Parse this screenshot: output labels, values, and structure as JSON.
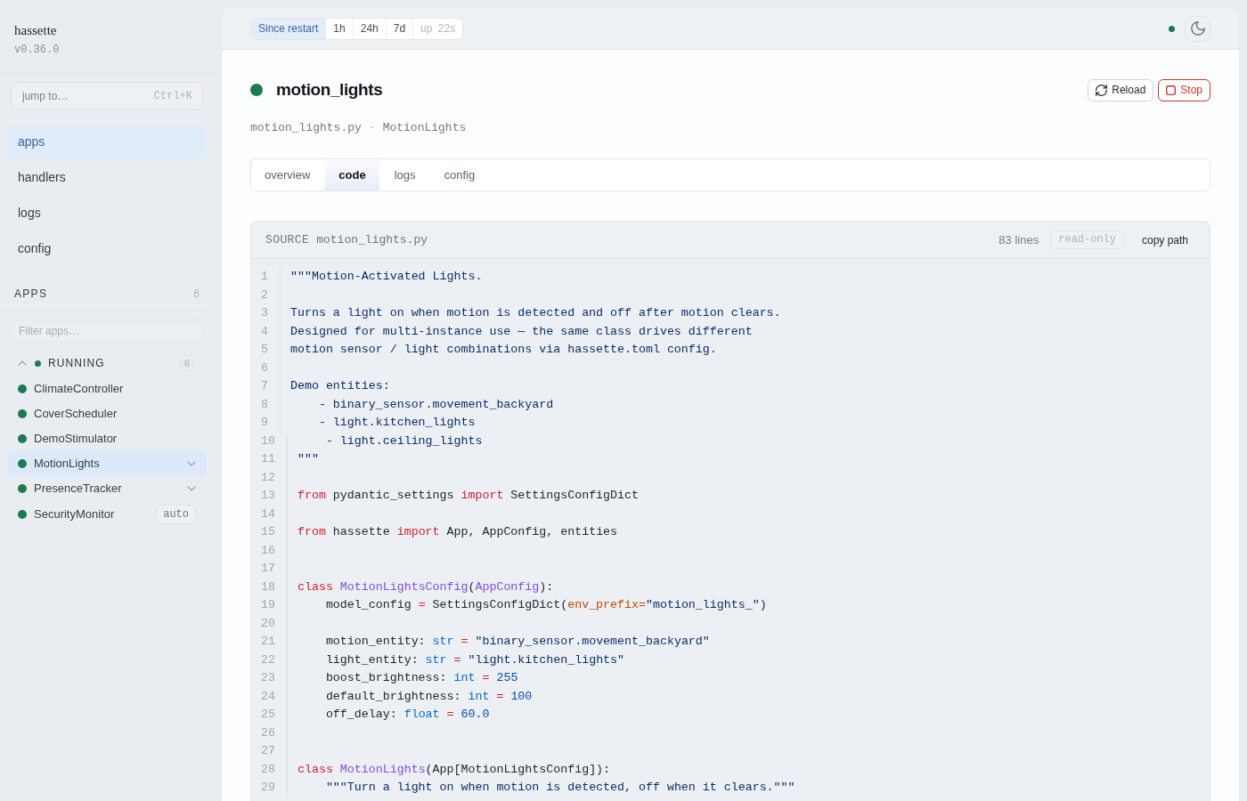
{
  "sidebar": {
    "brand": "hassette",
    "version": "v0.36.0",
    "jump": {
      "placeholder": "jump to…",
      "shortcut": "Ctrl+K"
    },
    "nav": [
      {
        "label": "apps",
        "selected": true
      },
      {
        "label": "handlers",
        "selected": false
      },
      {
        "label": "logs",
        "selected": false
      },
      {
        "label": "config",
        "selected": false
      }
    ],
    "apps_section": {
      "title": "APPS",
      "count": "6",
      "filter_placeholder": "Filter apps…",
      "groups": [
        {
          "label": "RUNNING",
          "running": true,
          "count": "6",
          "expanded": true,
          "apps": [
            {
              "name": "ClimateController",
              "running": true,
              "selected": false,
              "expandable": false
            },
            {
              "name": "CoverScheduler",
              "running": true,
              "selected": false,
              "expandable": false
            },
            {
              "name": "DemoStimulator",
              "running": true,
              "selected": false,
              "expandable": false
            },
            {
              "name": "MotionLights",
              "running": true,
              "selected": true,
              "expandable": true
            },
            {
              "name": "PresenceTracker",
              "running": true,
              "selected": false,
              "expandable": true
            },
            {
              "name": "SecurityMonitor",
              "running": true,
              "selected": false,
              "expandable": false,
              "badge": "auto"
            }
          ]
        }
      ]
    }
  },
  "top_bar": {
    "time_ranges": [
      {
        "label": "Since restart",
        "selected": true
      },
      {
        "label": "1h",
        "selected": false
      },
      {
        "label": "24h",
        "selected": false
      },
      {
        "label": "7d",
        "selected": false
      }
    ],
    "uptime": "up 22s",
    "connected": true
  },
  "app": {
    "name": "motion_lights",
    "running": true,
    "file": "motion_lights.py",
    "separator": "·",
    "class_name": "MotionLights",
    "actions": [
      {
        "label": "Reload",
        "kind": "reload"
      },
      {
        "label": "Stop",
        "kind": "stop"
      }
    ]
  },
  "tabs": [
    {
      "label": "overview",
      "selected": false
    },
    {
      "label": "code",
      "selected": true
    },
    {
      "label": "logs",
      "selected": false
    },
    {
      "label": "config",
      "selected": false
    }
  ],
  "source": {
    "label": "SOURCE",
    "file": "motion_lights.py",
    "line_count": "83 lines",
    "badge": "read-only",
    "action": "copy path",
    "lines": [
      {
        "number": "1",
        "tokens": [
          {
            "text": "\"\"\"Motion-Activated Lights.",
            "kind": "string"
          }
        ]
      },
      {
        "number": "2"
      },
      {
        "number": "3",
        "tokens": [
          {
            "text": "Turns a light on when motion is detected and off after motion clears.",
            "kind": "string"
          }
        ]
      },
      {
        "number": "4",
        "tokens": [
          {
            "text": "Designed for multi-instance use — the same class drives different",
            "kind": "string"
          }
        ]
      },
      {
        "number": "5",
        "tokens": [
          {
            "text": "motion sensor / light combinations via hassette.toml config.",
            "kind": "string"
          }
        ]
      },
      {
        "number": "6"
      },
      {
        "number": "7",
        "tokens": [
          {
            "text": "Demo entities:",
            "kind": "string"
          }
        ]
      },
      {
        "number": "8",
        "tokens": [
          {
            "text": "    - binary_sensor.movement_backyard",
            "kind": "string"
          }
        ]
      },
      {
        "number": "9",
        "tokens": [
          {
            "text": "    - light.kitchen_lights",
            "kind": "string"
          }
        ]
      },
      {
        "number": "10",
        "tokens": [
          {
            "text": "    - light.ceiling_lights",
            "kind": "string"
          }
        ]
      },
      {
        "number": "11",
        "tokens": [
          {
            "text": "\"\"\"",
            "kind": "string"
          }
        ]
      },
      {
        "number": "12"
      },
      {
        "number": "13",
        "tokens": [
          {
            "text": "from",
            "kind": "keyword"
          },
          {
            "text": " pydantic_settings ",
            "kind": "plain"
          },
          {
            "text": "import",
            "kind": "keyword"
          },
          {
            "text": " SettingsConfigDict",
            "kind": "plain"
          }
        ]
      },
      {
        "number": "14"
      },
      {
        "number": "15",
        "tokens": [
          {
            "text": "from",
            "kind": "keyword"
          },
          {
            "text": " hassette ",
            "kind": "plain"
          },
          {
            "text": "import",
            "kind": "keyword"
          },
          {
            "text": " App, AppConfig, entities",
            "kind": "plain"
          }
        ]
      },
      {
        "number": "16"
      },
      {
        "number": "17"
      },
      {
        "number": "18",
        "tokens": [
          {
            "text": "class",
            "kind": "keyword"
          },
          {
            "text": " MotionLightsConfig",
            "kind": "class"
          },
          {
            "text": "(",
            "kind": "plain"
          },
          {
            "text": "AppConfig",
            "kind": "class"
          },
          {
            "text": "):",
            "kind": "plain"
          }
        ]
      },
      {
        "number": "19",
        "tokens": [
          {
            "text": "    model_config ",
            "kind": "plain"
          },
          {
            "text": "=",
            "kind": "operator"
          },
          {
            "text": " SettingsConfigDict(",
            "kind": "plain"
          },
          {
            "text": "env_prefix=",
            "kind": "param"
          },
          {
            "text": "\"motion_lights_\"",
            "kind": "string"
          },
          {
            "text": ")",
            "kind": "plain"
          }
        ]
      },
      {
        "number": "20"
      },
      {
        "number": "21",
        "tokens": [
          {
            "text": "    motion_entity: ",
            "kind": "plain"
          },
          {
            "text": "str",
            "kind": "type"
          },
          {
            "text": " = ",
            "kind": "operator"
          },
          {
            "text": "\"binary_sensor.movement_backyard\"",
            "kind": "string"
          }
        ]
      },
      {
        "number": "22",
        "tokens": [
          {
            "text": "    light_entity: ",
            "kind": "plain"
          },
          {
            "text": "str",
            "kind": "type"
          },
          {
            "text": " = ",
            "kind": "operator"
          },
          {
            "text": "\"light.kitchen_lights\"",
            "kind": "string"
          }
        ]
      },
      {
        "number": "23",
        "tokens": [
          {
            "text": "    boost_brightness: ",
            "kind": "plain"
          },
          {
            "text": "int",
            "kind": "type"
          },
          {
            "text": " = ",
            "kind": "operator"
          },
          {
            "text": "255",
            "kind": "number"
          }
        ]
      },
      {
        "number": "24",
        "tokens": [
          {
            "text": "    default_brightness: ",
            "kind": "plain"
          },
          {
            "text": "int",
            "kind": "type"
          },
          {
            "text": " = ",
            "kind": "operator"
          },
          {
            "text": "100",
            "kind": "number"
          }
        ]
      },
      {
        "number": "25",
        "tokens": [
          {
            "text": "    off_delay: ",
            "kind": "plain"
          },
          {
            "text": "float",
            "kind": "type"
          },
          {
            "text": " = ",
            "kind": "operator"
          },
          {
            "text": "60.0",
            "kind": "number"
          }
        ]
      },
      {
        "number": "26"
      },
      {
        "number": "27"
      },
      {
        "number": "28",
        "tokens": [
          {
            "text": "class",
            "kind": "keyword"
          },
          {
            "text": " MotionLights",
            "kind": "class"
          },
          {
            "text": "(App[MotionLightsConfig]):",
            "kind": "plain"
          }
        ]
      },
      {
        "number": "29",
        "tokens": [
          {
            "text": "    \"\"\"Turn a light on when motion is detected, off when it clears.\"\"\"",
            "kind": "string"
          }
        ]
      }
    ]
  }
}
